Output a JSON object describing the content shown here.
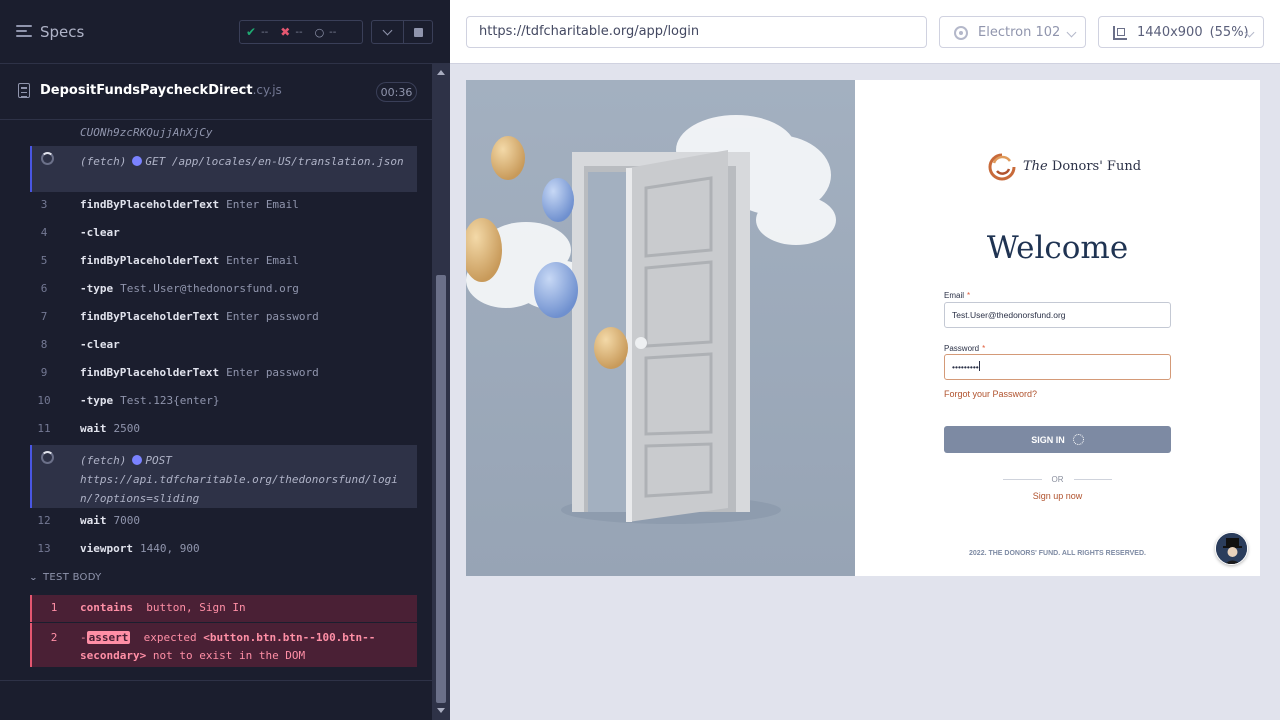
{
  "reporter": {
    "specs_label": "Specs",
    "stats": {
      "passed": "--",
      "failed": "--",
      "pending": "--"
    },
    "spec": {
      "name": "DepositFundsPaycheckDirect",
      "ext": ".cy.js",
      "duration": "00:36"
    },
    "commands": [
      {
        "type": "partial",
        "text": "CUONh9zcRKQujjAhXjCy"
      },
      {
        "type": "request",
        "kind": "(fetch)",
        "method": "GET",
        "url": "/app/locales/en-US/translation.json"
      },
      {
        "num": "3",
        "name": "findByPlaceholderText",
        "message": "Enter Email"
      },
      {
        "num": "4",
        "name": "-clear",
        "message": ""
      },
      {
        "num": "5",
        "name": "findByPlaceholderText",
        "message": "Enter Email"
      },
      {
        "num": "6",
        "name": "-type",
        "message": "Test.User@thedonorsfund.org"
      },
      {
        "num": "7",
        "name": "findByPlaceholderText",
        "message": "Enter password"
      },
      {
        "num": "8",
        "name": "-clear",
        "message": ""
      },
      {
        "num": "9",
        "name": "findByPlaceholderText",
        "message": "Enter password"
      },
      {
        "num": "10",
        "name": "-type",
        "message": "Test.123{enter}"
      },
      {
        "num": "11",
        "name": "wait",
        "message": "2500"
      },
      {
        "type": "request",
        "kind": "(fetch)",
        "method": "POST",
        "url": "https://api.tdfcharitable.org/thedonorsfund/login/?options=sliding"
      },
      {
        "num": "12",
        "name": "wait",
        "message": "7000"
      },
      {
        "num": "13",
        "name": "viewport",
        "message": "1440, 900"
      }
    ],
    "test_body_label": "TEST BODY",
    "test_body": [
      {
        "num": "1",
        "name": "contains",
        "message": "button, Sign In"
      },
      {
        "num": "2",
        "prefix": "-",
        "tag": "assert",
        "message_a": "expected",
        "message_b": "<button.btn.btn--100.btn--secondary>",
        "message_c": "not to exist in the DOM"
      }
    ]
  },
  "browser": {
    "url": "https://tdfcharitable.org/app/login",
    "browser_name": "Electron 102",
    "viewport_size": "1440x900",
    "viewport_scale": "(55%)"
  },
  "app": {
    "brand_name_italic": "The",
    "brand_name": "Donors' Fund",
    "welcome": "Welcome",
    "email_label": "Email",
    "email_value": "Test.User@thedonorsfund.org",
    "password_label": "Password",
    "password_value": "•••••••••",
    "forgot_link": "Forgot your Password?",
    "signin_button": "SIGN IN",
    "or_text": "OR",
    "signup_link": "Sign up now",
    "copyright": "2022. THE DONORS' FUND. ALL RIGHTS RESERVED.",
    "required_marker": "*"
  },
  "colors": {
    "reporter_bg": "#1b1e2e",
    "request_accent": "#4956e3",
    "fail_bg": "#4a2035",
    "fail_text": "#ff8fa6",
    "brand_navy": "#1f3352",
    "brand_orange": "#b0522d",
    "signin_bg": "#7d8aa3"
  },
  "icons": [
    "menu-icon",
    "check-icon",
    "x-icon",
    "pending-icon",
    "chevron-down-icon",
    "stop-icon",
    "file-icon",
    "spinner-icon",
    "electron-icon",
    "viewport-icon",
    "brand-logo-icon"
  ]
}
